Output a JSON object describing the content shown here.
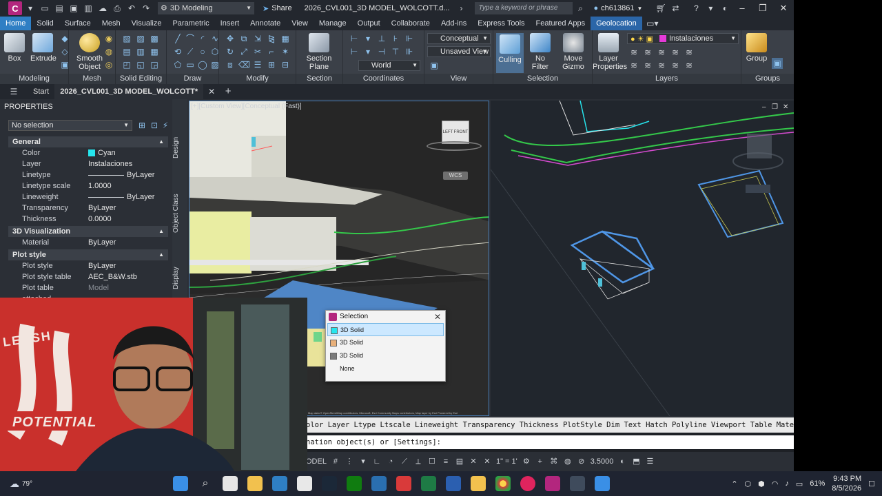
{
  "titlebar": {
    "app_letter": "C",
    "workspace": "3D Modeling",
    "share_label": "Share",
    "document_title": "2026_CVL001_3D MODEL_WOLCOTT.d...",
    "search_placeholder": "Type a keyword or phrase",
    "username": "ch613861"
  },
  "ribbon_tabs": [
    "Home",
    "Solid",
    "Surface",
    "Mesh",
    "Visualize",
    "Parametric",
    "Insert",
    "Annotate",
    "View",
    "Manage",
    "Output",
    "Collaborate",
    "Add-ins",
    "Express Tools",
    "Featured Apps",
    "Geolocation"
  ],
  "ribbon": {
    "box": "Box",
    "extrude": "Extrude",
    "smooth_object": "Smooth Object",
    "section_plane": "Section Plane",
    "culling": "Culling",
    "no_filter": "No Filter",
    "move_gizmo": "Move Gizmo",
    "layer_properties": "Layer Properties",
    "group": "Group",
    "visual_style": "Conceptual",
    "view_state": "Unsaved View",
    "ucs": "World",
    "layer_current": "Instalaciones",
    "panels": {
      "modeling": "Modeling",
      "mesh": "Mesh",
      "solid_editing": "Solid Editing",
      "draw": "Draw",
      "modify": "Modify",
      "section": "Section",
      "coordinates": "Coordinates",
      "view": "View",
      "selection": "Selection",
      "layers": "Layers",
      "groups": "Groups"
    }
  },
  "file_tabs": {
    "start": "Start",
    "active": "2026_CVL001_3D MODEL_WOLCOTT*"
  },
  "properties": {
    "header": "PROPERTIES",
    "selection": "No selection",
    "general_title": "General",
    "general": [
      {
        "name": "Color",
        "value": "Cyan"
      },
      {
        "name": "Layer",
        "value": "Instalaciones"
      },
      {
        "name": "Linetype",
        "value": "ByLayer"
      },
      {
        "name": "Linetype scale",
        "value": "1.0000"
      },
      {
        "name": "Lineweight",
        "value": "ByLayer"
      },
      {
        "name": "Transparency",
        "value": "ByLayer"
      },
      {
        "name": "Thickness",
        "value": "0.0000"
      }
    ],
    "viz_title": "3D Visualization",
    "viz": [
      {
        "name": "Material",
        "value": "ByLayer"
      }
    ],
    "plot_title": "Plot style",
    "plot": [
      {
        "name": "Plot style",
        "value": "ByLayer"
      },
      {
        "name": "Plot style table",
        "value": "AEC_B&W.stb"
      },
      {
        "name": "Plot table attached...",
        "value": "Model"
      }
    ],
    "vtabs": [
      "Design",
      "Object Class",
      "Display"
    ],
    "cyan_color": "#26e6ee"
  },
  "viewport_left": {
    "label": "[+][Custom View][Conceptual (Fast)]",
    "wcs": "WCS",
    "cube_left": "LEFT",
    "cube_front": "FRONT",
    "attribution": "Map data © OpenStreetMap contributors, Microsoft, Esri Community Maps contributors, Map layer by Esri Powered by Esri"
  },
  "selection_dialog": {
    "title": "Selection",
    "items": [
      {
        "label": "3D Solid",
        "color": "#26e6ee"
      },
      {
        "label": "3D Solid",
        "color": "#e8b07a"
      },
      {
        "label": "3D Solid",
        "color": "#7a7a7a"
      },
      {
        "label": "None",
        "color": ""
      }
    ]
  },
  "command": {
    "line1": "olor Layer Ltype Ltscale Lineweight Transparency Thickness PlotStyle Dim Text Hatch Polyline Viewport Table Material",
    "line2": "nation object(s) or [Settings]:"
  },
  "statusbar": {
    "model": "ODEL",
    "scale": "1\" = 1'",
    "value": "3.5000"
  },
  "taskbar": {
    "weather": "79°",
    "battery": "61%",
    "time": "9:43 PM",
    "date": "8/5/2026"
  },
  "webcam": {
    "banner_text": "POTENTIAL",
    "wall_text": "LEASH"
  }
}
